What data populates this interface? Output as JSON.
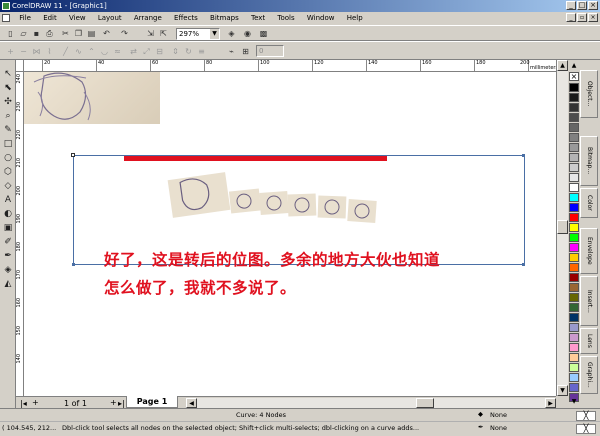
{
  "window": {
    "title": "CorelDRAW 11 - [Graphic1]"
  },
  "menu": [
    "File",
    "Edit",
    "View",
    "Layout",
    "Arrange",
    "Effects",
    "Bitmaps",
    "Text",
    "Tools",
    "Window",
    "Help"
  ],
  "toolbar": {
    "zoom": "297%",
    "nudge": "0"
  },
  "ruler": {
    "unit": "millimeters",
    "h_ticks": [
      "20",
      "40",
      "60",
      "80",
      "100",
      "120",
      "140",
      "160",
      "180",
      "200"
    ],
    "v_ticks": [
      "240",
      "230",
      "220",
      "210",
      "200",
      "190",
      "180",
      "170",
      "160",
      "150",
      "140"
    ]
  },
  "canvas": {
    "caption_line1": "好了，这是转后的位图。多余的地方大伙也知道",
    "caption_line2": "怎么做了，我就不多说了。"
  },
  "page_nav": {
    "page_count": "1 of 1",
    "tab": "Page 1"
  },
  "docker_tabs": [
    "Object...",
    "Bitmap...",
    "Color",
    "Envelope",
    "Insert...",
    "Lens",
    "Graphi..."
  ],
  "palette_colors": [
    "#000000",
    "#1a1a1a",
    "#333333",
    "#4d4d4d",
    "#666666",
    "#808080",
    "#999999",
    "#b3b3b3",
    "#cccccc",
    "#e6e6e6",
    "#ffffff",
    "#00ffff",
    "#0000ff",
    "#ff0000",
    "#ffff00",
    "#00ff00",
    "#ff00ff",
    "#ffcc00",
    "#ff6600",
    "#990000",
    "#996633",
    "#666600",
    "#336633",
    "#003366",
    "#9999cc",
    "#cc99cc",
    "#ff99cc",
    "#ffcc99",
    "#ccff99",
    "#99ccff",
    "#6666cc",
    "#663399"
  ],
  "status": {
    "center": "Curve: 4 Nodes",
    "coords": "( 104.545, 212...",
    "hint": "Dbl-click tool selects all nodes on the selected object; Shift+click multi-selects; dbl-clicking on a curve adds...",
    "fill": "None",
    "outline": "None"
  },
  "colors": {
    "accent_red": "#e0111f",
    "titlebar": "#08246b",
    "selection": "#4a6fa5"
  }
}
